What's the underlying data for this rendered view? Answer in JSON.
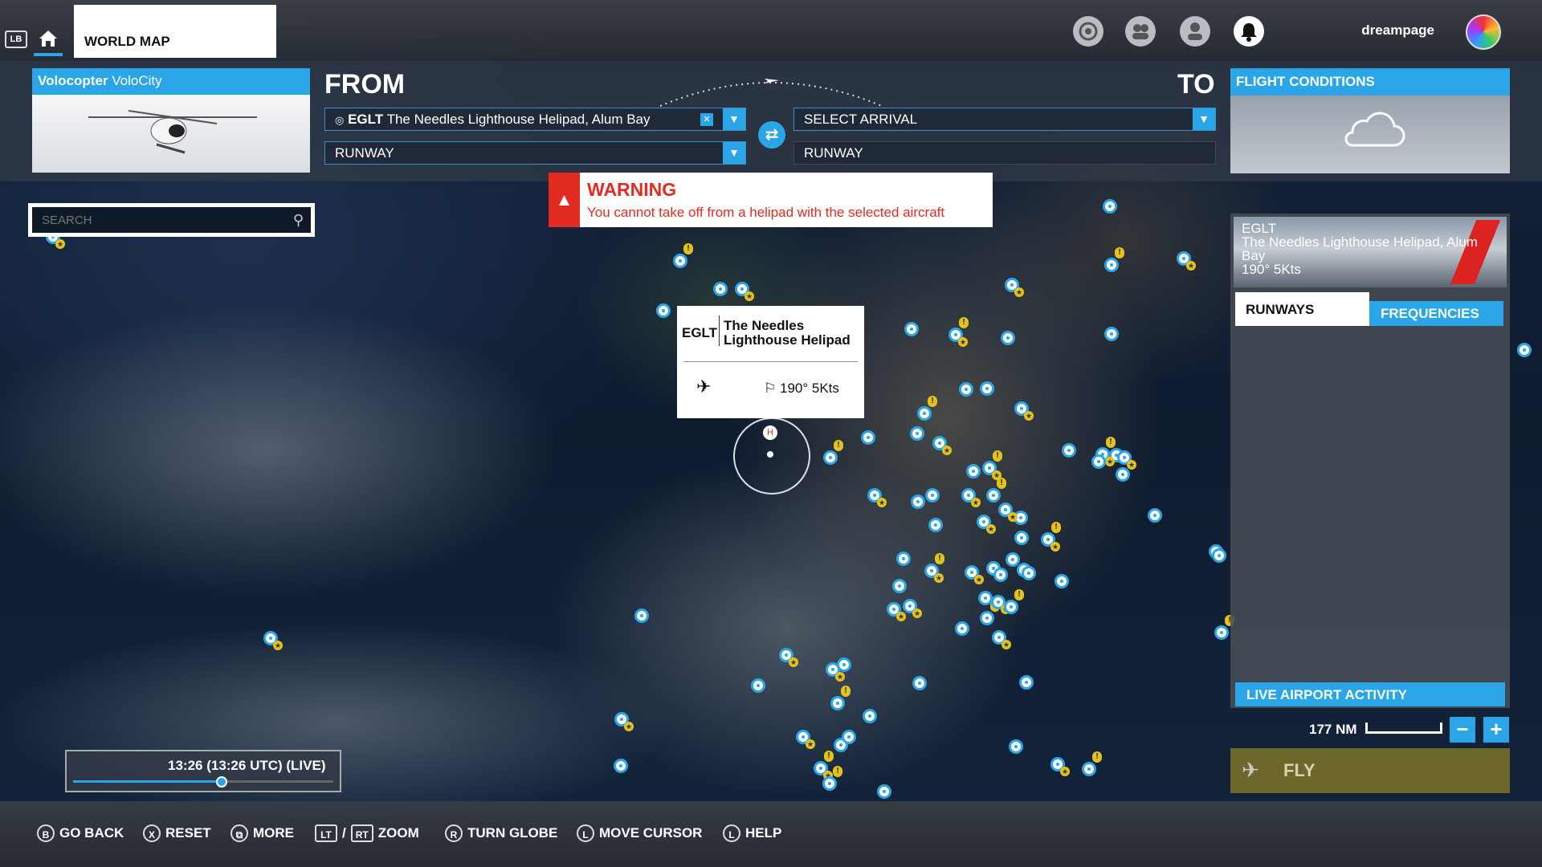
{
  "topbar": {
    "lb_label": "LB",
    "home_icon": "home-icon",
    "tab_label": "WORLD MAP",
    "icons": [
      "lightning-icon",
      "friends-icon",
      "profile-icon",
      "notifications-icon"
    ],
    "username": "dreampage"
  },
  "aircraft": {
    "brand": "Volocopter",
    "model": "VoloCity"
  },
  "route": {
    "from_label": "FROM",
    "to_label": "TO",
    "departure": "EGLT The Needles Lighthouse Helipad, Alum Bay",
    "departure_code": "EGLT",
    "departure_name": "The Needles Lighthouse Helipad, Alum Bay",
    "departure_runway": "RUNWAY",
    "arrival": "SELECT ARRIVAL",
    "arrival_runway": "RUNWAY"
  },
  "conditions": {
    "title": "FLIGHT CONDITIONS",
    "icon": "cloud-icon"
  },
  "warning": {
    "title": "WARNING",
    "message": "You cannot take off from a helipad with the selected aircraft"
  },
  "search": {
    "placeholder": "SEARCH"
  },
  "popup": {
    "code": "EGLT",
    "name": "The Needles Lighthouse Helipad",
    "wind": "190° 5Kts"
  },
  "airport_panel": {
    "code": "EGLT",
    "name": "The Needles Lighthouse Helipad, Alum Bay",
    "wind": "190° 5Kts",
    "tabs": [
      "RUNWAYS",
      "FREQUENCIES"
    ],
    "live_activity": "LIVE AIRPORT ACTIVITY"
  },
  "map": {
    "scale": "177 NM"
  },
  "fly": {
    "label": "FLY"
  },
  "time": {
    "text": "13:26 (13:26 UTC) (LIVE)",
    "progress": 0.57
  },
  "bottombar": [
    {
      "key": "B",
      "label": "GO BACK"
    },
    {
      "key": "X",
      "label": "RESET"
    },
    {
      "key": "⧉",
      "label": "MORE"
    },
    {
      "key": "LT",
      "label": "/"
    },
    {
      "key": "RT",
      "label": "ZOOM"
    },
    {
      "key": "R",
      "label": "TURN GLOBE"
    },
    {
      "key": "L",
      "label": "MOVE CURSOR"
    },
    {
      "key": "L",
      "label": "HELP"
    }
  ],
  "colors": {
    "accent": "#2aa6e8",
    "warning": "#e32b22",
    "marker_star": "#e4c21c"
  }
}
